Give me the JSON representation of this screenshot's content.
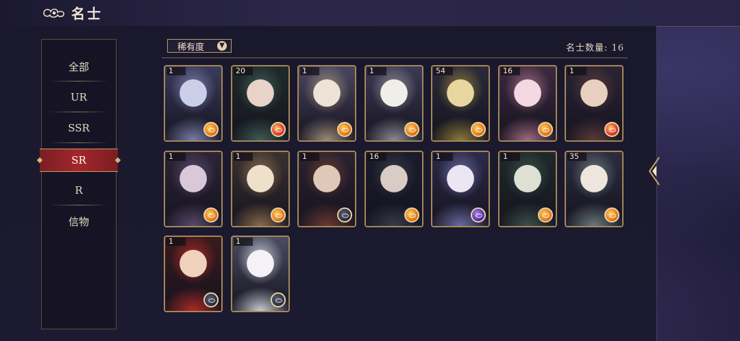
{
  "header": {
    "title": "名士",
    "icon": "cloud-emblem-icon"
  },
  "sidebar": {
    "items": [
      {
        "label": "全部"
      },
      {
        "label": "UR"
      },
      {
        "label": "SSR"
      },
      {
        "label": "SR",
        "active": true
      },
      {
        "label": "R"
      },
      {
        "label": "信物"
      }
    ]
  },
  "filter": {
    "label": "稀有度",
    "icon": "chevron-down-icon"
  },
  "count": {
    "label": "名士数量: 16"
  },
  "cards": [
    {
      "level": "1",
      "badge": "gold",
      "palette": [
        "#3a3a5c",
        "#7a7fa8",
        "#cbd0e8"
      ]
    },
    {
      "level": "20",
      "badge": "red",
      "palette": [
        "#1f2a2a",
        "#3f5c55",
        "#e7d3c8"
      ]
    },
    {
      "level": "1",
      "badge": "gold",
      "palette": [
        "#4a4660",
        "#9a8d7a",
        "#ece2d6"
      ]
    },
    {
      "level": "1",
      "badge": "gold",
      "palette": [
        "#3c3a54",
        "#8c8a92",
        "#f0eee8"
      ]
    },
    {
      "level": "54",
      "badge": "gold",
      "palette": [
        "#2a2a3a",
        "#8a7a3a",
        "#e8d6a0"
      ]
    },
    {
      "level": "16",
      "badge": "gold",
      "palette": [
        "#3c2a40",
        "#a06a80",
        "#f2d8e0"
      ]
    },
    {
      "level": "1",
      "badge": "red",
      "palette": [
        "#2a2434",
        "#5a3a3a",
        "#e8d0c0"
      ]
    },
    {
      "level": "1",
      "badge": "gold",
      "palette": [
        "#2c2438",
        "#5a4a6a",
        "#d8c8d8"
      ]
    },
    {
      "level": "1",
      "badge": "gold",
      "palette": [
        "#3a3230",
        "#8a6a4a",
        "#efe0cc"
      ]
    },
    {
      "level": "1",
      "badge": "dark",
      "palette": [
        "#2a2230",
        "#6a3a30",
        "#e0c8b8"
      ]
    },
    {
      "level": "16",
      "badge": "gold",
      "palette": [
        "#1a1c2c",
        "#3a3a4a",
        "#d8ccc4"
      ]
    },
    {
      "level": "1",
      "badge": "purple",
      "palette": [
        "#2c2a48",
        "#6a6aa0",
        "#ece6f2"
      ]
    },
    {
      "level": "1",
      "badge": "gold",
      "palette": [
        "#1e2a2a",
        "#3a5048",
        "#dfe0d4"
      ]
    },
    {
      "level": "35",
      "badge": "gold",
      "palette": [
        "#2c2c40",
        "#6a7a7a",
        "#eee6dc"
      ]
    },
    {
      "level": "1",
      "badge": "dark",
      "palette": [
        "#3a1a1c",
        "#b02a26",
        "#f0d2bc"
      ]
    },
    {
      "level": "1",
      "badge": "dark",
      "palette": [
        "#4a4c60",
        "#c8ccd8",
        "#f4f2f4"
      ]
    }
  ],
  "right_nav": {
    "icon": "arrow-left-icon"
  }
}
